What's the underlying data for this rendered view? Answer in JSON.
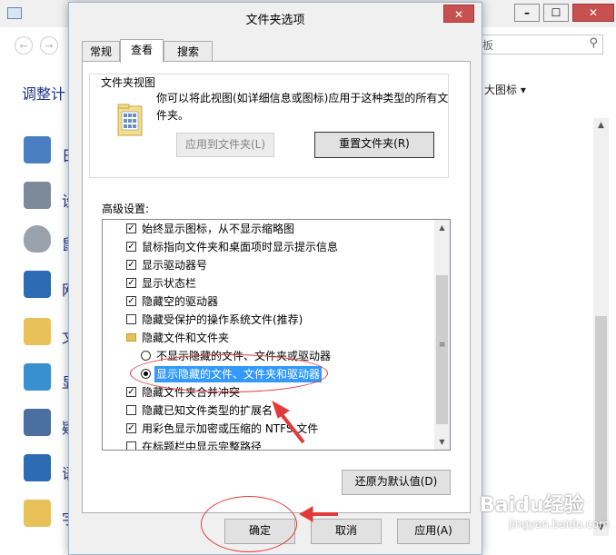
{
  "dialog": {
    "title": "文件夹选项",
    "close_glyph": "✕",
    "tabs": [
      {
        "label": "常规",
        "active": false
      },
      {
        "label": "查看",
        "active": true
      },
      {
        "label": "搜索",
        "active": false
      }
    ],
    "folder_views": {
      "title": "文件夹视图",
      "description": "你可以将此视图(如详细信息或图标)应用于这种类型的所有文件夹。",
      "apply_button": "应用到文件夹(L)",
      "reset_button": "重置文件夹(R)"
    },
    "advanced_label": "高级设置:",
    "advanced_items": [
      {
        "type": "checkbox",
        "checked": true,
        "label": "始终显示图标，从不显示缩略图"
      },
      {
        "type": "checkbox",
        "checked": true,
        "label": "鼠标指向文件夹和桌面项时显示提示信息"
      },
      {
        "type": "checkbox",
        "checked": true,
        "label": "显示驱动器号"
      },
      {
        "type": "checkbox",
        "checked": true,
        "label": "显示状态栏"
      },
      {
        "type": "checkbox",
        "checked": true,
        "label": "隐藏空的驱动器"
      },
      {
        "type": "checkbox",
        "checked": false,
        "label": "隐藏受保护的操作系统文件(推荐)"
      },
      {
        "type": "folder",
        "label": "隐藏文件和文件夹"
      },
      {
        "type": "radio",
        "checked": false,
        "label": "不显示隐藏的文件、文件夹或驱动器"
      },
      {
        "type": "radio",
        "checked": true,
        "selected": true,
        "label": "显示隐藏的文件、文件夹和驱动器"
      },
      {
        "type": "checkbox",
        "checked": true,
        "label": "隐藏文件夹合并冲突"
      },
      {
        "type": "checkbox",
        "checked": false,
        "label": "隐藏已知文件类型的扩展名"
      },
      {
        "type": "checkbox",
        "checked": true,
        "label": "用彩色显示加密或压缩的 NTFS 文件"
      },
      {
        "type": "checkbox",
        "checked": false,
        "label": "在标题栏中显示完整路径"
      }
    ],
    "restore_defaults_button": "还原为默认值(D)",
    "ok_button": "确定",
    "cancel_button": "取消",
    "apply_button": "应用(A)"
  },
  "background_window": {
    "title_buttons": [
      "–",
      "☐",
      "✕"
    ],
    "search_text": "板",
    "heading": "调整计",
    "view_label": "大图标 ▾",
    "items": [
      {
        "label": "日",
        "icon": "calendar-icon",
        "color": "#4a7fc1"
      },
      {
        "label": "设",
        "icon": "printer-icon",
        "color": "#7c8a99"
      },
      {
        "label": "鼠",
        "icon": "mouse-icon",
        "color": "#9aa3ad"
      },
      {
        "label": "网",
        "icon": "network-icon",
        "color": "#2d6bb5"
      },
      {
        "label": "文",
        "icon": "folder-icon",
        "color": "#e8c15a"
      },
      {
        "label": "显",
        "icon": "display-icon",
        "color": "#3a8fd0"
      },
      {
        "label": "疑",
        "icon": "troubleshoot-icon",
        "color": "#4b6f9e"
      },
      {
        "label": "语",
        "icon": "language-icon",
        "color": "#2d6bb5"
      },
      {
        "label": "字",
        "icon": "font-icon",
        "color": "#e8c15a"
      }
    ]
  },
  "annotations": {
    "highlight_color": "#e23a3a"
  },
  "watermark": {
    "text": "Baidu经验",
    "sub": "jingyan.baidu.com"
  }
}
